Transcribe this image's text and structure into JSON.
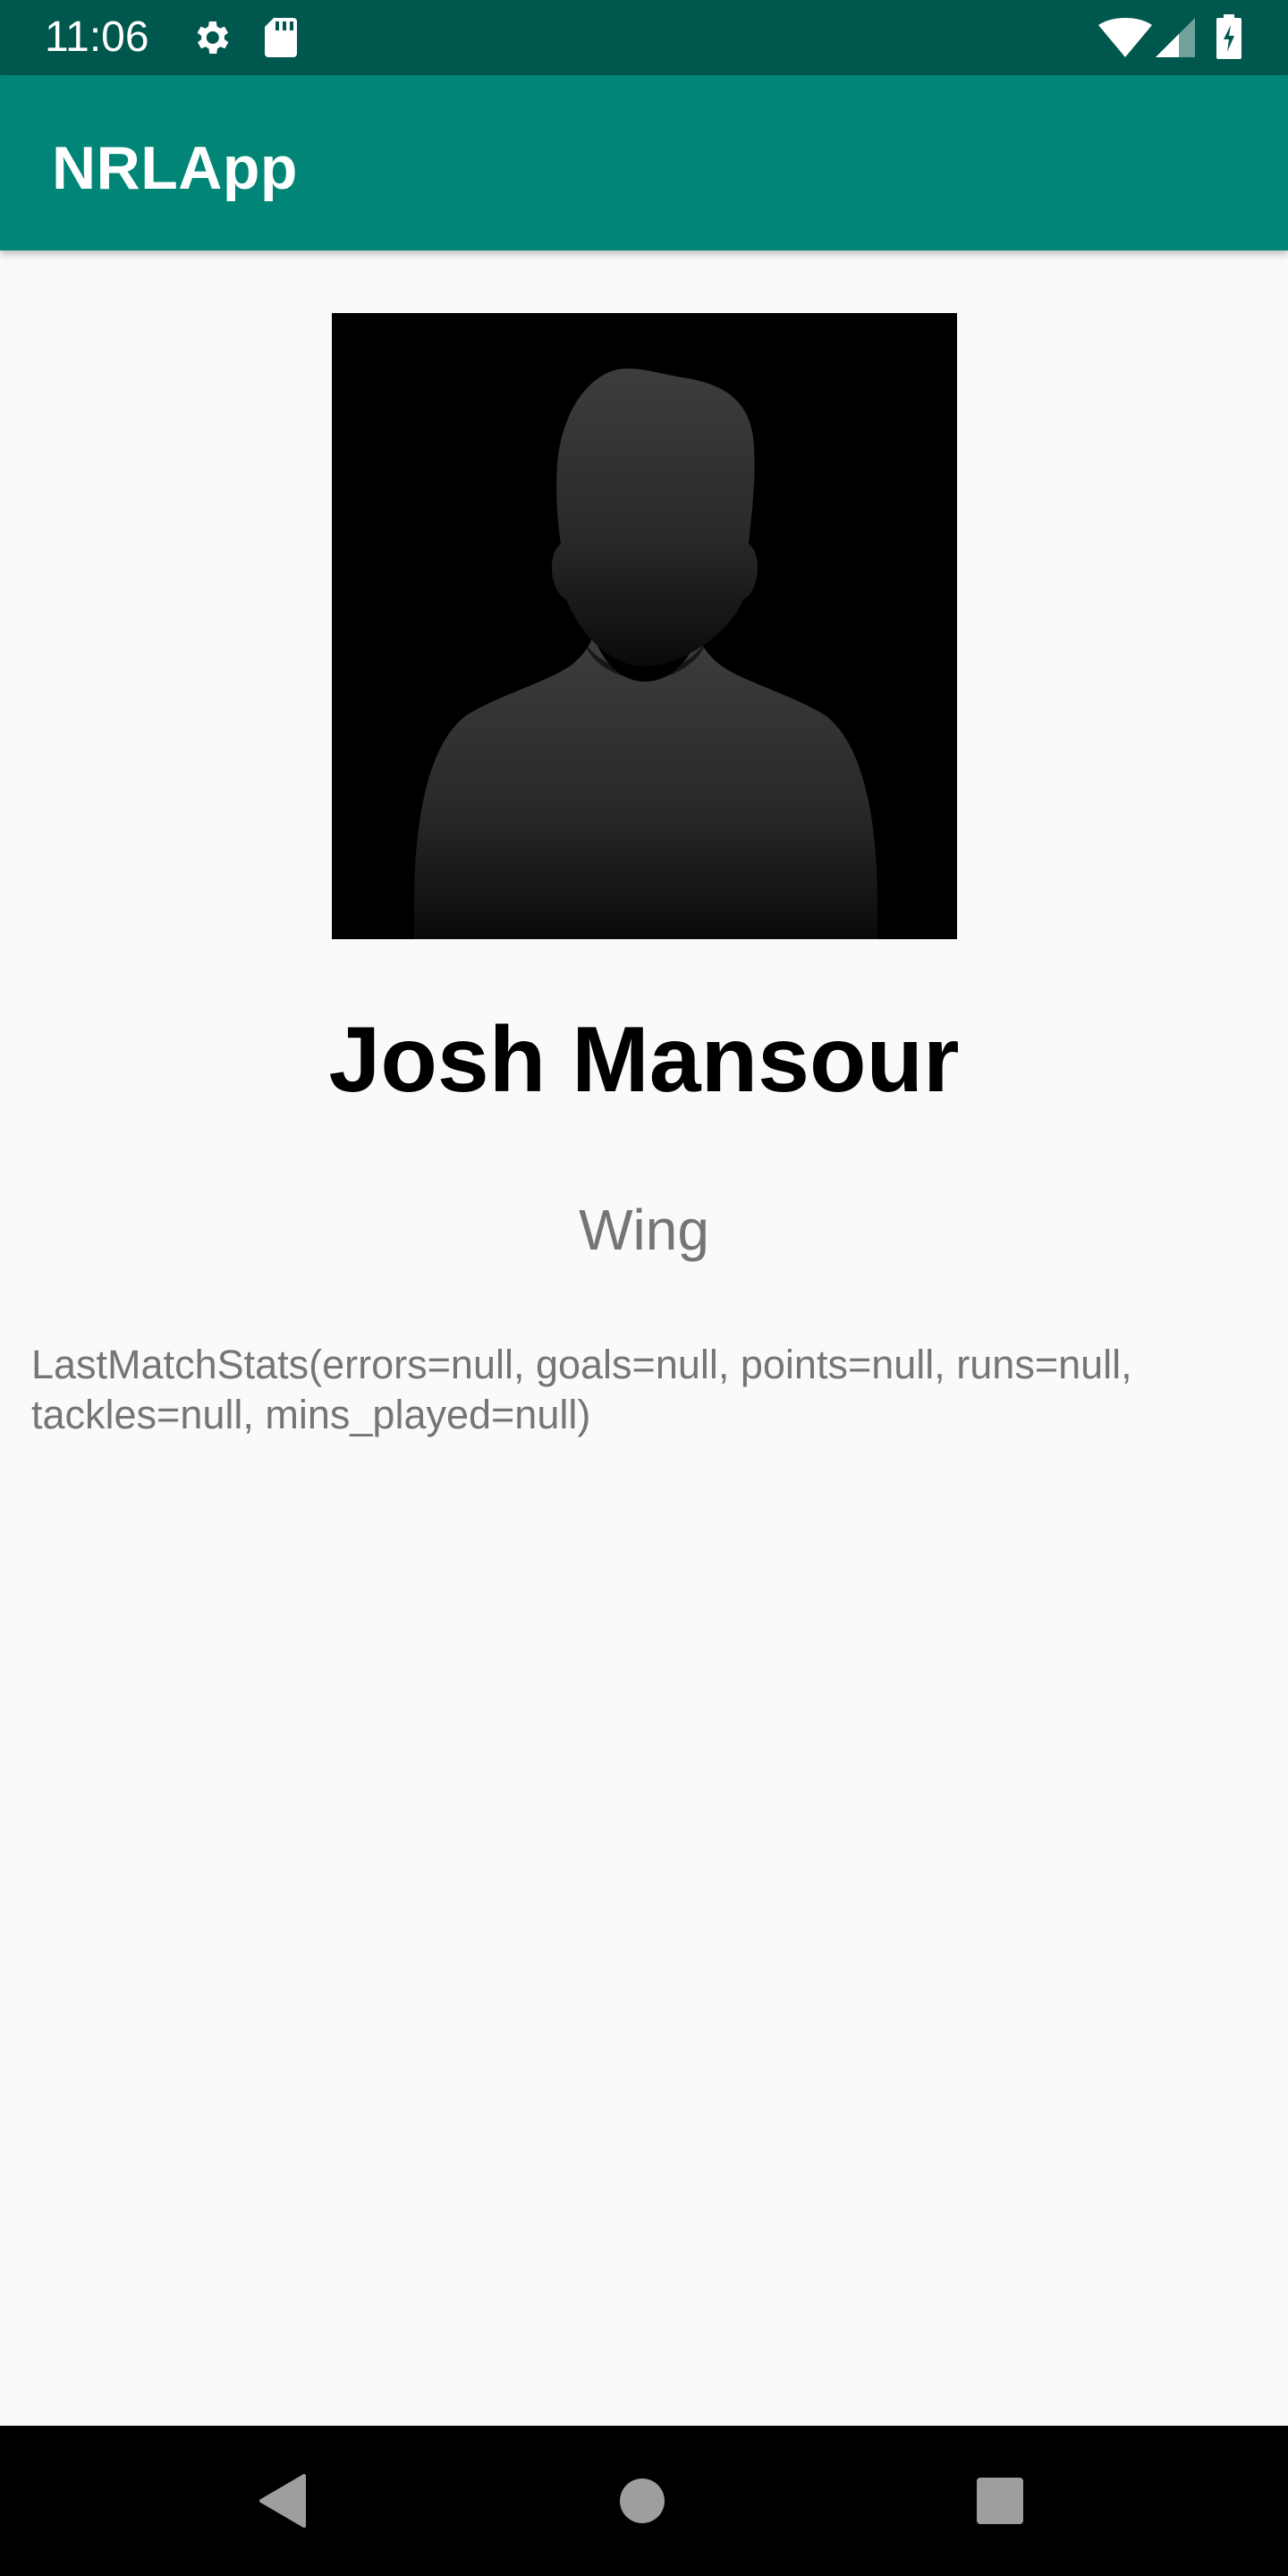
{
  "status_bar": {
    "time": "11:06",
    "icons": [
      "gear-icon",
      "sd-card-icon",
      "wifi-icon",
      "cell-signal-icon",
      "battery-charging-icon"
    ]
  },
  "app_bar": {
    "title": "NRLApp"
  },
  "player": {
    "photo_icon": "person-silhouette-icon",
    "name": "Josh Mansour",
    "position": "Wing",
    "stats": "LastMatchStats(errors=null, goals=null, points=null, runs=null, tackles=null, mins_played=null)"
  },
  "nav_bar": {
    "buttons": [
      "back-icon",
      "home-icon",
      "recents-icon"
    ]
  },
  "colors": {
    "status_bar": "#00574d",
    "app_bar": "#008577",
    "background": "#fafafa",
    "secondary_text": "#757575"
  }
}
